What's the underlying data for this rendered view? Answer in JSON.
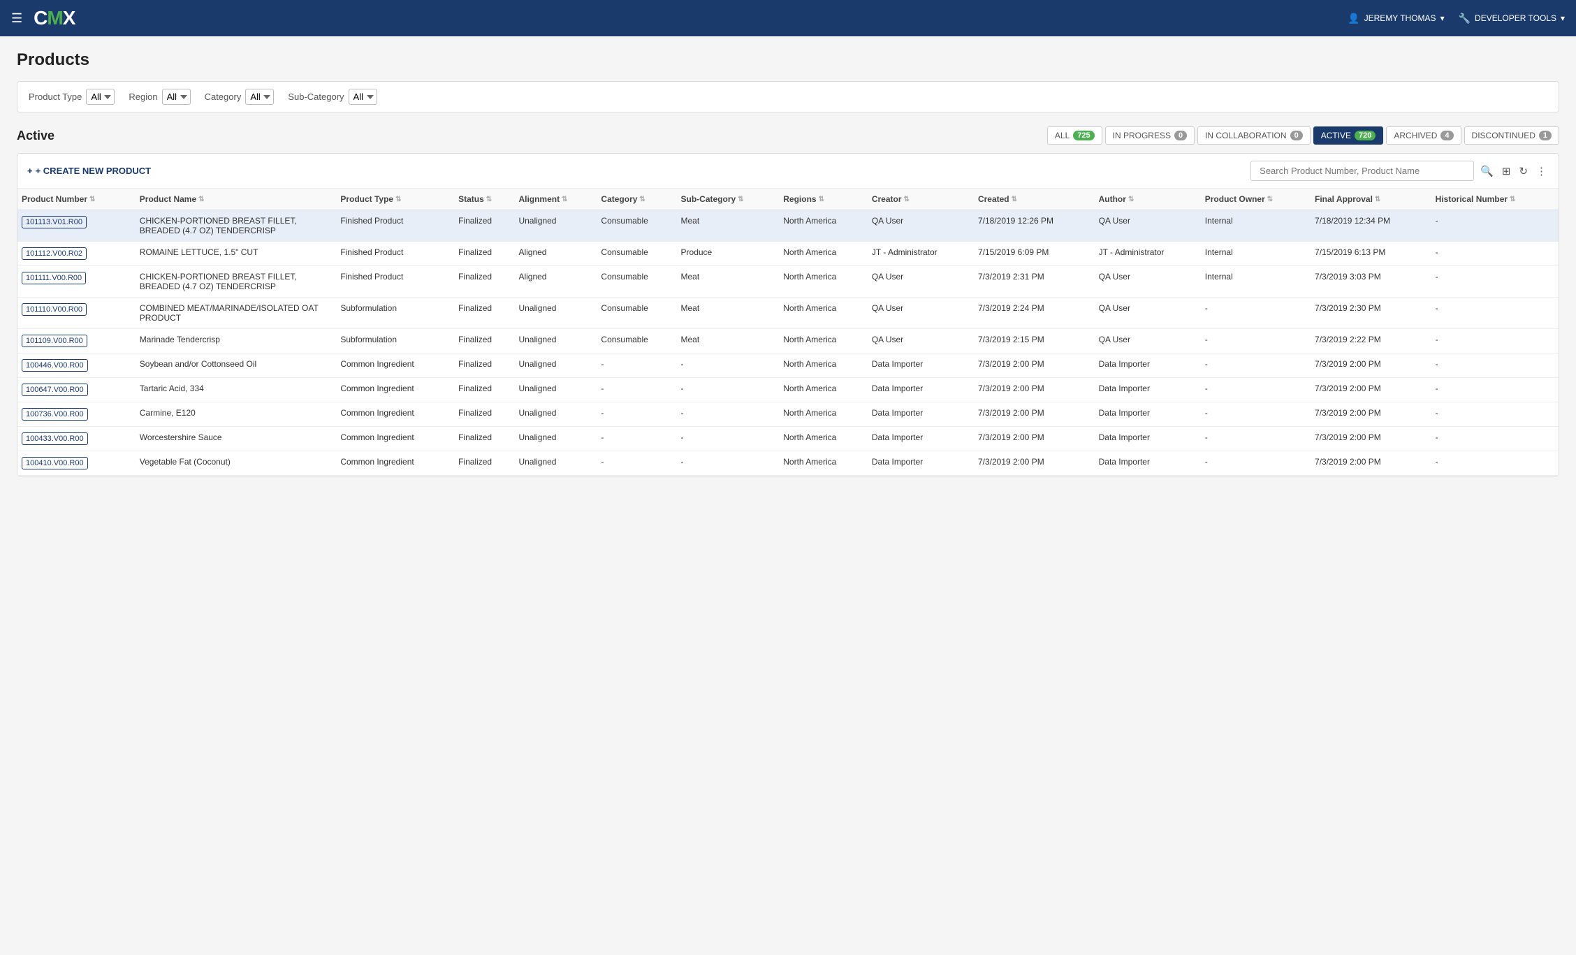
{
  "header": {
    "hamburger_icon": "☰",
    "logo_c": "C",
    "logo_m": "M",
    "logo_x": "X",
    "user_icon": "👤",
    "user_name": "JEREMY THOMAS",
    "user_arrow": "▾",
    "devtools_icon": "🔧",
    "devtools_label": "DEVELOPER TOOLS",
    "devtools_arrow": "▾"
  },
  "page": {
    "title": "Products"
  },
  "filters": {
    "product_type_label": "Product Type",
    "product_type_value": "All",
    "region_label": "Region",
    "region_value": "All",
    "category_label": "Category",
    "category_value": "All",
    "subcategory_label": "Sub-Category",
    "subcategory_value": "All"
  },
  "section": {
    "title": "Active",
    "tabs": [
      {
        "key": "all",
        "label": "ALL",
        "count": "725",
        "active": false
      },
      {
        "key": "in_progress",
        "label": "IN PROGRESS",
        "count": "0",
        "active": false
      },
      {
        "key": "in_collaboration",
        "label": "IN COLLABORATION",
        "count": "0",
        "active": false
      },
      {
        "key": "active",
        "label": "ACTIVE",
        "count": "720",
        "active": true
      },
      {
        "key": "archived",
        "label": "ARCHIVED",
        "count": "4",
        "active": false
      },
      {
        "key": "discontinued",
        "label": "DISCONTINUED",
        "count": "1",
        "active": false
      }
    ]
  },
  "toolbar": {
    "create_label": "+ CREATE NEW PRODUCT",
    "search_placeholder": "Search Product Number, Product Name"
  },
  "table": {
    "columns": [
      "Product Number",
      "Product Name",
      "Product Type",
      "Status",
      "Alignment",
      "Category",
      "Sub-Category",
      "Regions",
      "Creator",
      "Created",
      "Author",
      "Product Owner",
      "Final Approval",
      "Historical Number"
    ],
    "rows": [
      {
        "product_number": "101113.V01.R00",
        "product_name": "CHICKEN-PORTIONED BREAST FILLET, BREADED (4.7 OZ) TENDERCRISP",
        "product_type": "Finished Product",
        "status": "Finalized",
        "alignment": "Unaligned",
        "category": "Consumable",
        "sub_category": "Meat",
        "regions": "North America",
        "creator": "QA User",
        "created": "7/18/2019 12:26 PM",
        "author": "QA User",
        "product_owner": "Internal",
        "final_approval": "7/18/2019 12:34 PM",
        "historical_number": "-",
        "selected": true
      },
      {
        "product_number": "101112.V00.R02",
        "product_name": "ROMAINE LETTUCE, 1.5\" CUT",
        "product_type": "Finished Product",
        "status": "Finalized",
        "alignment": "Aligned",
        "category": "Consumable",
        "sub_category": "Produce",
        "regions": "North America",
        "creator": "JT - Administrator",
        "created": "7/15/2019 6:09 PM",
        "author": "JT - Administrator",
        "product_owner": "Internal",
        "final_approval": "7/15/2019 6:13 PM",
        "historical_number": "-",
        "selected": false
      },
      {
        "product_number": "101111.V00.R00",
        "product_name": "CHICKEN-PORTIONED BREAST FILLET, BREADED (4.7 OZ) TENDERCRISP",
        "product_type": "Finished Product",
        "status": "Finalized",
        "alignment": "Aligned",
        "category": "Consumable",
        "sub_category": "Meat",
        "regions": "North America",
        "creator": "QA User",
        "created": "7/3/2019 2:31 PM",
        "author": "QA User",
        "product_owner": "Internal",
        "final_approval": "7/3/2019 3:03 PM",
        "historical_number": "-",
        "selected": false
      },
      {
        "product_number": "101110.V00.R00",
        "product_name": "COMBINED MEAT/MARINADE/ISOLATED OAT PRODUCT",
        "product_type": "Subformulation",
        "status": "Finalized",
        "alignment": "Unaligned",
        "category": "Consumable",
        "sub_category": "Meat",
        "regions": "North America",
        "creator": "QA User",
        "created": "7/3/2019 2:24 PM",
        "author": "QA User",
        "product_owner": "-",
        "final_approval": "7/3/2019 2:30 PM",
        "historical_number": "-",
        "selected": false
      },
      {
        "product_number": "101109.V00.R00",
        "product_name": "Marinade Tendercrisp",
        "product_type": "Subformulation",
        "status": "Finalized",
        "alignment": "Unaligned",
        "category": "Consumable",
        "sub_category": "Meat",
        "regions": "North America",
        "creator": "QA User",
        "created": "7/3/2019 2:15 PM",
        "author": "QA User",
        "product_owner": "-",
        "final_approval": "7/3/2019 2:22 PM",
        "historical_number": "-",
        "selected": false
      },
      {
        "product_number": "100446.V00.R00",
        "product_name": "Soybean and/or Cottonseed Oil",
        "product_type": "Common Ingredient",
        "status": "Finalized",
        "alignment": "Unaligned",
        "category": "-",
        "sub_category": "-",
        "regions": "North America",
        "creator": "Data Importer",
        "created": "7/3/2019 2:00 PM",
        "author": "Data Importer",
        "product_owner": "-",
        "final_approval": "7/3/2019 2:00 PM",
        "historical_number": "-",
        "selected": false
      },
      {
        "product_number": "100647.V00.R00",
        "product_name": "Tartaric Acid, 334",
        "product_type": "Common Ingredient",
        "status": "Finalized",
        "alignment": "Unaligned",
        "category": "-",
        "sub_category": "-",
        "regions": "North America",
        "creator": "Data Importer",
        "created": "7/3/2019 2:00 PM",
        "author": "Data Importer",
        "product_owner": "-",
        "final_approval": "7/3/2019 2:00 PM",
        "historical_number": "-",
        "selected": false
      },
      {
        "product_number": "100736.V00.R00",
        "product_name": "Carmine, E120",
        "product_type": "Common Ingredient",
        "status": "Finalized",
        "alignment": "Unaligned",
        "category": "-",
        "sub_category": "-",
        "regions": "North America",
        "creator": "Data Importer",
        "created": "7/3/2019 2:00 PM",
        "author": "Data Importer",
        "product_owner": "-",
        "final_approval": "7/3/2019 2:00 PM",
        "historical_number": "-",
        "selected": false
      },
      {
        "product_number": "100433.V00.R00",
        "product_name": "Worcestershire Sauce",
        "product_type": "Common Ingredient",
        "status": "Finalized",
        "alignment": "Unaligned",
        "category": "-",
        "sub_category": "-",
        "regions": "North America",
        "creator": "Data Importer",
        "created": "7/3/2019 2:00 PM",
        "author": "Data Importer",
        "product_owner": "-",
        "final_approval": "7/3/2019 2:00 PM",
        "historical_number": "-",
        "selected": false
      },
      {
        "product_number": "100410.V00.R00",
        "product_name": "Vegetable Fat (Coconut)",
        "product_type": "Common Ingredient",
        "status": "Finalized",
        "alignment": "Unaligned",
        "category": "-",
        "sub_category": "-",
        "regions": "North America",
        "creator": "Data Importer",
        "created": "7/3/2019 2:00 PM",
        "author": "Data Importer",
        "product_owner": "-",
        "final_approval": "7/3/2019 2:00 PM",
        "historical_number": "-",
        "selected": false
      }
    ]
  }
}
